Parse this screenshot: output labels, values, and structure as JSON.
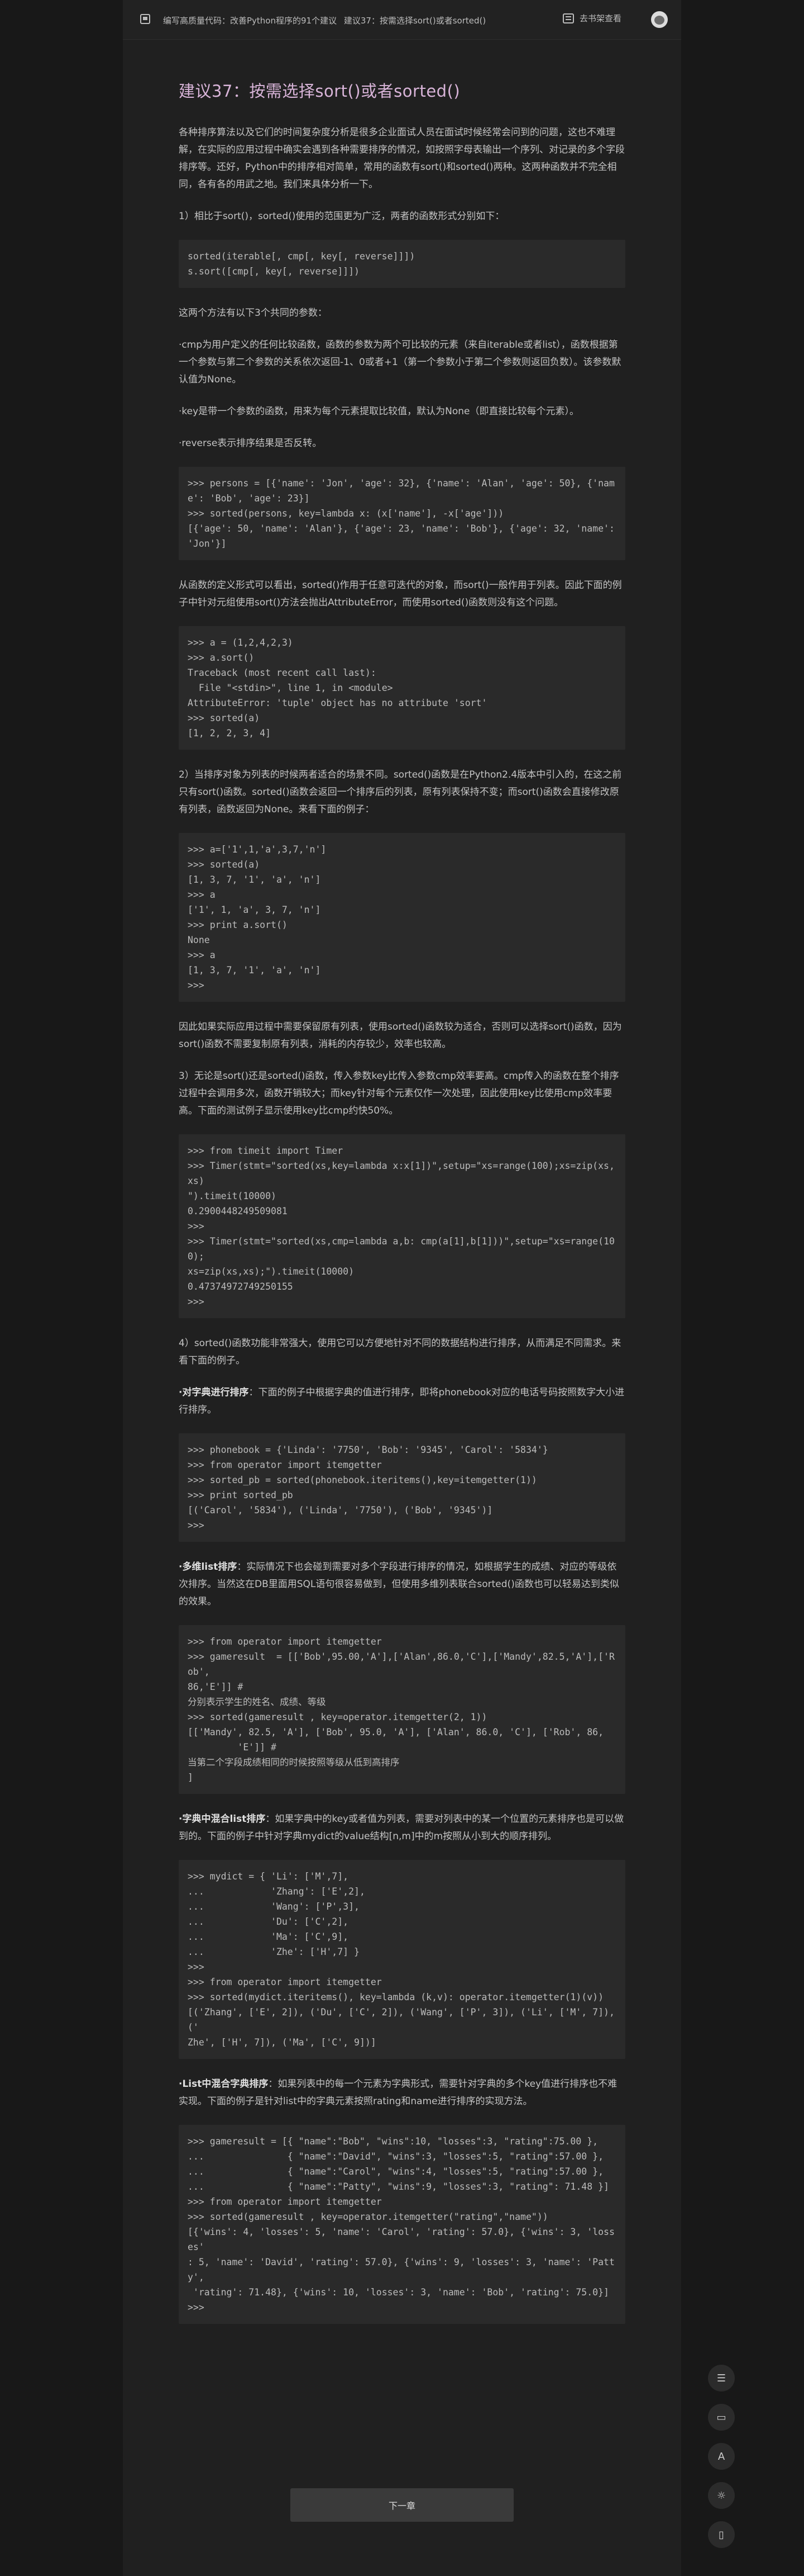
{
  "topbar": {
    "book_title": "编写高质量代码：改善Python程序的91个建议",
    "chapter": "建议37：按需选择sort()或者sorted()",
    "shelf_label": "去书架查看"
  },
  "article": {
    "title": "建议37：按需选择sort()或者sorted()",
    "blocks": [
      {
        "type": "p",
        "text": "各种排序算法以及它们的时间复杂度分析是很多企业面试人员在面试时候经常会问到的问题，这也不难理解，在实际的应用过程中确实会遇到各种需要排序的情况，如按照字母表输出一个序列、对记录的多个字段排序等。还好，Python中的排序相对简单，常用的函数有sort()和sorted()两种。这两种函数并不完全相同，各有各的用武之地。我们来具体分析一下。"
      },
      {
        "type": "p",
        "text": "1）相比于sort()，sorted()使用的范围更为广泛，两者的函数形式分别如下："
      },
      {
        "type": "code",
        "text": "sorted(iterable[, cmp[, key[, reverse]]])\ns.sort([cmp[, key[, reverse]]])"
      },
      {
        "type": "p",
        "text": "这两个方法有以下3个共同的参数："
      },
      {
        "type": "p",
        "text": "·cmp为用户定义的任何比较函数，函数的参数为两个可比较的元素（来自iterable或者list），函数根据第一个参数与第二个参数的关系依次返回-1、0或者+1（第一个参数小于第二个参数则返回负数）。该参数默认值为None。"
      },
      {
        "type": "p",
        "text": "·key是带一个参数的函数，用来为每个元素提取比较值，默认为None（即直接比较每个元素）。"
      },
      {
        "type": "p",
        "text": "·reverse表示排序结果是否反转。"
      },
      {
        "type": "code",
        "text": ">>> persons = [{'name': 'Jon', 'age': 32}, {'name': 'Alan', 'age': 50}, {'name': 'Bob', 'age': 23}]\n>>> sorted(persons, key=lambda x: (x['name'], -x['age']))\n[{'age': 50, 'name': 'Alan'}, {'age': 23, 'name': 'Bob'}, {'age': 32, 'name': 'Jon'}]"
      },
      {
        "type": "p",
        "text": "从函数的定义形式可以看出，sorted()作用于任意可迭代的对象，而sort()一般作用于列表。因此下面的例子中针对元组使用sort()方法会抛出AttributeError，而使用sorted()函数则没有这个问题。"
      },
      {
        "type": "code",
        "text": ">>> a = (1,2,4,2,3)\n>>> a.sort()\nTraceback (most recent call last):\n  File \"<stdin>\", line 1, in <module>\nAttributeError: 'tuple' object has no attribute 'sort'\n>>> sorted(a)\n[1, 2, 2, 3, 4]"
      },
      {
        "type": "p",
        "text": "2）当排序对象为列表的时候两者适合的场景不同。sorted()函数是在Python2.4版本中引入的，在这之前只有sort()函数。sorted()函数会返回一个排序后的列表，原有列表保持不变；而sort()函数会直接修改原有列表，函数返回为None。来看下面的例子："
      },
      {
        "type": "code",
        "text": ">>> a=['1',1,'a',3,7,'n']\n>>> sorted(a)\n[1, 3, 7, '1', 'a', 'n']\n>>> a\n['1', 1, 'a', 3, 7, 'n']\n>>> print a.sort()\nNone\n>>> a\n[1, 3, 7, '1', 'a', 'n']\n>>>"
      },
      {
        "type": "p",
        "text": "因此如果实际应用过程中需要保留原有列表，使用sorted()函数较为适合，否则可以选择sort()函数，因为sort()函数不需要复制原有列表，消耗的内存较少，效率也较高。"
      },
      {
        "type": "p",
        "text": "3）无论是sort()还是sorted()函数，传入参数key比传入参数cmp效率要高。cmp传入的函数在整个排序过程中会调用多次，函数开销较大；而key针对每个元素仅作一次处理，因此使用key比使用cmp效率要高。下面的测试例子显示使用key比cmp约快50%。"
      },
      {
        "type": "code",
        "text": ">>> from timeit import Timer\n>>> Timer(stmt=\"sorted(xs,key=lambda x:x[1])\",setup=\"xs=range(100);xs=zip(xs,xs)\n\").timeit(10000)\n0.2900448249509081\n>>>\n>>> Timer(stmt=\"sorted(xs,cmp=lambda a,b: cmp(a[1],b[1]))\",setup=\"xs=range(100);\nxs=zip(xs,xs);\").timeit(10000)\n0.47374972749250155\n>>>"
      },
      {
        "type": "p",
        "text": "4）sorted()函数功能非常强大，使用它可以方便地针对不同的数据结构进行排序，从而满足不同需求。来看下面的例子。"
      },
      {
        "type": "p",
        "bold": "·对字典进行排序",
        "text": "：下面的例子中根据字典的值进行排序，即将phonebook对应的电话号码按照数字大小进行排序。"
      },
      {
        "type": "code",
        "text": ">>> phonebook = {'Linda': '7750', 'Bob': '9345', 'Carol': '5834'}\n>>> from operator import itemgetter\n>>> sorted_pb = sorted(phonebook.iteritems(),key=itemgetter(1))\n>>> print sorted_pb\n[('Carol', '5834'), ('Linda', '7750'), ('Bob', '9345')]\n>>>"
      },
      {
        "type": "p",
        "bold": "·多维list排序",
        "text": "：实际情况下也会碰到需要对多个字段进行排序的情况，如根据学生的成绩、对应的等级依次排序。当然这在DB里面用SQL语句很容易做到，但使用多维列表联合sorted()函数也可以轻易达到类似的效果。"
      },
      {
        "type": "code",
        "text": ">>> from operator import itemgetter\n>>> gameresult  = [['Bob',95.00,'A'],['Alan',86.0,'C'],['Mandy',82.5,'A'],['Rob',\n86,'E']] #\n分别表示学生的姓名、成绩、等级\n>>> sorted(gameresult , key=operator.itemgetter(2, 1))\n[['Mandy', 82.5, 'A'], ['Bob', 95.0, 'A'], ['Alan', 86.0, 'C'], ['Rob', 86,\n         'E']] #\n当第二个字段成绩相同的时候按照等级从低到高排序\n]"
      },
      {
        "type": "p",
        "bold": "·字典中混合list排序",
        "text": "：如果字典中的key或者值为列表，需要对列表中的某一个位置的元素排序也是可以做到的。下面的例子中针对字典mydict的value结构[n,m]中的m按照从小到大的顺序排列。"
      },
      {
        "type": "code",
        "text": ">>> mydict = { 'Li': ['M',7],\n...            'Zhang': ['E',2],\n...            'Wang': ['P',3],\n...            'Du': ['C',2],\n...            'Ma': ['C',9],\n...            'Zhe': ['H',7] }\n>>>\n>>> from operator import itemgetter\n>>> sorted(mydict.iteritems(), key=lambda (k,v): operator.itemgetter(1)(v))\n[('Zhang', ['E', 2]), ('Du', ['C', 2]), ('Wang', ['P', 3]), ('Li', ['M', 7]), ('\nZhe', ['H', 7]), ('Ma', ['C', 9])]"
      },
      {
        "type": "p",
        "bold": "·List中混合字典排序",
        "text": "：如果列表中的每一个元素为字典形式，需要针对字典的多个key值进行排序也不难实现。下面的例子是针对list中的字典元素按照rating和name进行排序的实现方法。"
      },
      {
        "type": "code",
        "text": ">>> gameresult = [{ \"name\":\"Bob\", \"wins\":10, \"losses\":3, \"rating\":75.00 },\n...               { \"name\":\"David\", \"wins\":3, \"losses\":5, \"rating\":57.00 },\n...               { \"name\":\"Carol\", \"wins\":4, \"losses\":5, \"rating\":57.00 },\n...               { \"name\":\"Patty\", \"wins\":9, \"losses\":3, \"rating\": 71.48 }]\n>>> from operator import itemgetter\n>>> sorted(gameresult , key=operator.itemgetter(\"rating\",\"name\"))\n[{'wins': 4, 'losses': 5, 'name': 'Carol', 'rating': 57.0}, {'wins': 3, 'losses'\n: 5, 'name': 'David', 'rating': 57.0}, {'wins': 9, 'losses': 3, 'name': 'Patty',\n 'rating': 71.48}, {'wins': 10, 'losses': 3, 'name': 'Bob', 'rating': 75.0}]\n>>>"
      }
    ]
  },
  "footer": {
    "next_label": "下一章"
  },
  "side_tools": [
    {
      "name": "toc-icon",
      "glyph": "☰"
    },
    {
      "name": "comment-icon",
      "glyph": "▭"
    },
    {
      "name": "font-icon",
      "glyph": "A"
    },
    {
      "name": "theme-icon",
      "glyph": "☼"
    },
    {
      "name": "phone-icon",
      "glyph": "▯"
    }
  ]
}
